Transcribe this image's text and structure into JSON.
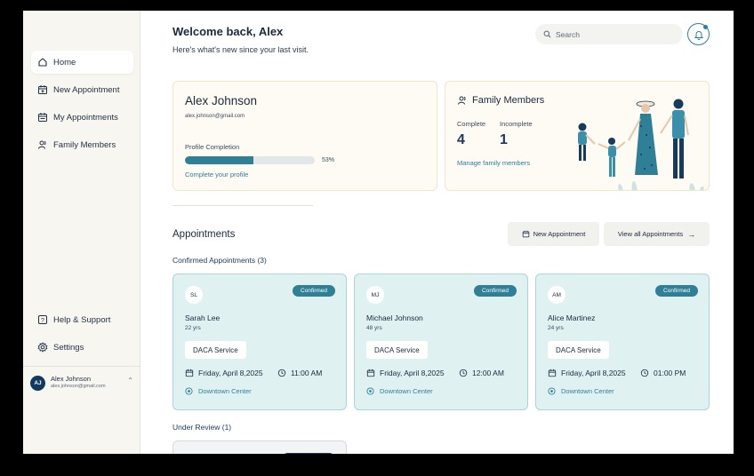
{
  "sidebar": {
    "items": [
      {
        "label": "Home",
        "icon": "home-icon"
      },
      {
        "label": "New Appointment",
        "icon": "calendar-plus-icon"
      },
      {
        "label": "My Appointments",
        "icon": "calendar-icon"
      },
      {
        "label": "Family Members",
        "icon": "users-icon"
      }
    ],
    "bottom": [
      {
        "label": "Help & Support",
        "icon": "help-icon"
      },
      {
        "label": "Settings",
        "icon": "gear-icon"
      }
    ],
    "user": {
      "initials": "AJ",
      "name": "Alex Johnson",
      "email": "alex.johnson@gmail.com"
    }
  },
  "header": {
    "welcome": "Welcome back, Alex",
    "subtitle": "Here's what's new since your last visit.",
    "search_placeholder": "Search"
  },
  "profile": {
    "name": "Alex Johnson",
    "email": "alex.johnson@gmail.com",
    "completion_label": "Profile Completion",
    "completion_percent": 53,
    "completion_text": "53%",
    "complete_link": "Complete your profile"
  },
  "family": {
    "title": "Family Members",
    "complete_label": "Complete",
    "complete_count": "4",
    "incomplete_label": "Incomplete",
    "incomplete_count": "1",
    "manage_link": "Manage family members"
  },
  "appointments": {
    "title": "Appointments",
    "new_button": "New Appointment",
    "view_all_button": "View all Appointments",
    "confirmed_heading": "Confirmed Appointments (3)",
    "confirmed": [
      {
        "initials": "SL",
        "status": "Confirmed",
        "name": "Sarah Lee",
        "age": "22 yrs",
        "service": "DACA Service",
        "date": "Friday,  April 8,2025",
        "time": "11:00 AM",
        "location": "Downtown Center"
      },
      {
        "initials": "MJ",
        "status": "Confirmed",
        "name": "Michael Johnson",
        "age": "48 yrs",
        "service": "DACA Service",
        "date": "Friday,  April 8,2025",
        "time": "12:00 AM",
        "location": "Downtown Center"
      },
      {
        "initials": "AM",
        "status": "Confirmed",
        "name": "Alice Martinez",
        "age": "24 yrs",
        "service": "DACA Service",
        "date": "Friday,  April 8,2025",
        "time": "01:00 PM",
        "location": "Downtown Center"
      }
    ],
    "review_heading": "Under Review (1)"
  },
  "colors": {
    "accent": "#2f7f96",
    "card_bg": "#e0f1f2",
    "sidebar_bg": "#f7f6f1",
    "navy": "#123a5c"
  }
}
